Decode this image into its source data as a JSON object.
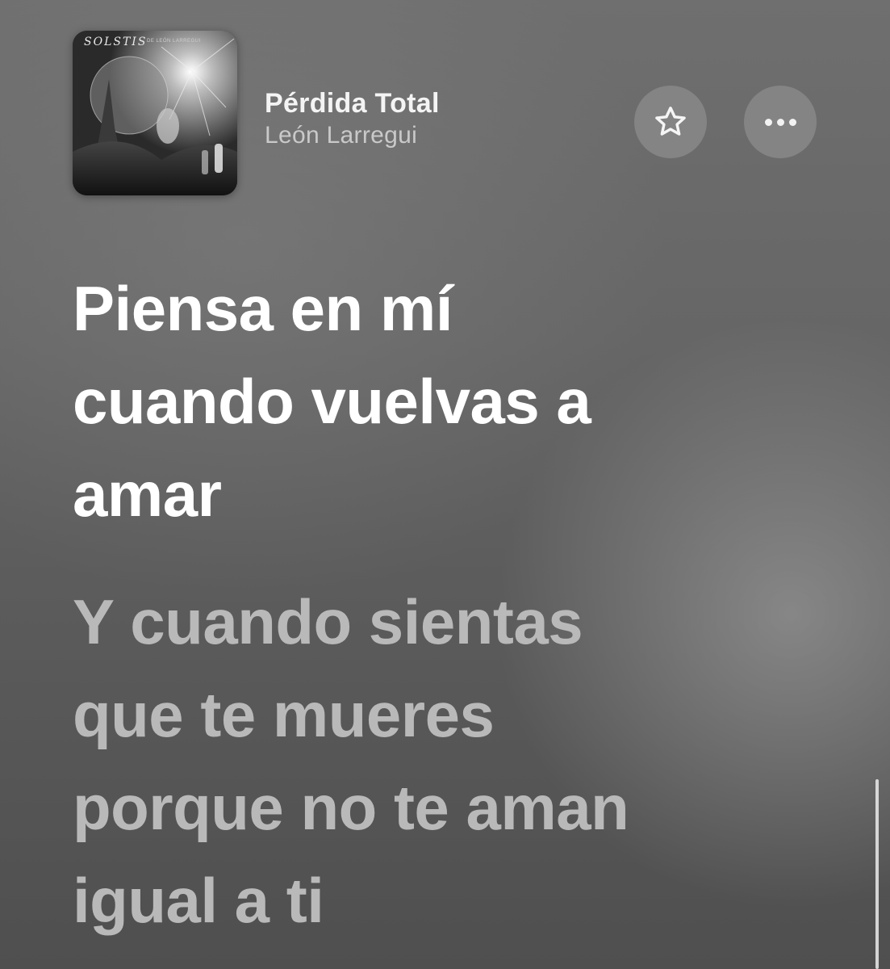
{
  "album": {
    "cover_title": "SOLSTIS",
    "cover_subtitle": "DE LEÓN LARREGUI"
  },
  "track": {
    "title": "Pérdida Total",
    "artist": "León Larregui"
  },
  "actions": {
    "favorite_icon": "star-icon",
    "more_icon": "ellipsis-icon"
  },
  "lyrics": {
    "current": [
      "Piensa en mí",
      "cuando vuelvas a",
      "amar"
    ],
    "next": [
      "Y cuando sientas",
      "que te mueres",
      "porque no te aman",
      "igual a ti"
    ]
  },
  "colors": {
    "lyric_active": "#ffffff",
    "lyric_inactive": "#b9b9b9",
    "background": "#666666"
  }
}
